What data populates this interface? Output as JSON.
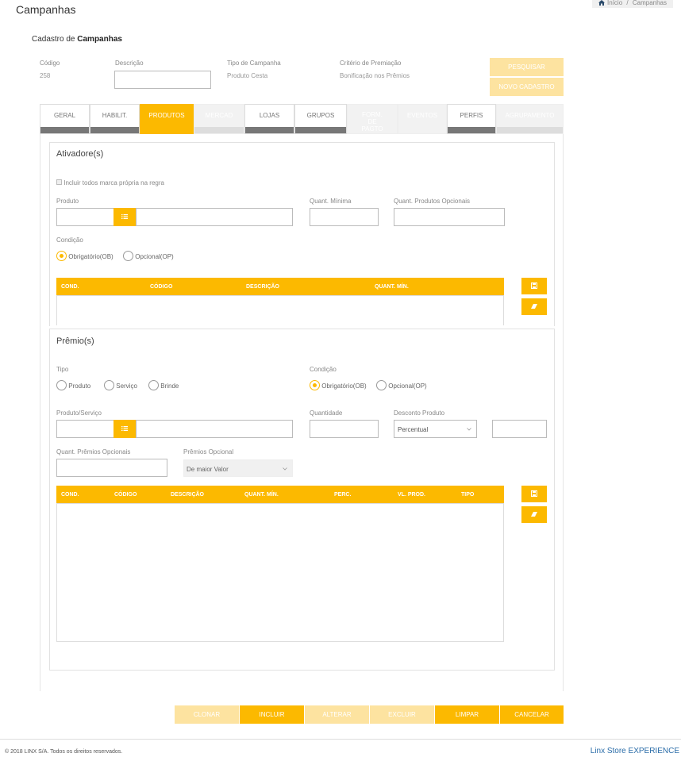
{
  "page": {
    "title": "Campanhas",
    "breadcrumb": {
      "home": "Início",
      "separator": "/",
      "current": "Campanhas"
    },
    "subtitle_prefix": "Cadastro de",
    "subtitle_bold": "Campanhas"
  },
  "header_fields": {
    "codigo_label": "Código",
    "codigo_value": "258",
    "descricao_label": "Descrição",
    "tipo_label": "Tipo de Campanha",
    "tipo_value": "Produto Cesta",
    "criterio_label": "Critério de Premiação",
    "criterio_value": "Bonificação nos Prêmios"
  },
  "actions": {
    "pesquisar": "PESQUISAR",
    "novo": "NOVO CADASTRO"
  },
  "tabs": [
    {
      "label": "GERAL",
      "state": "normal"
    },
    {
      "label": "HABILIT.",
      "state": "normal"
    },
    {
      "label": "PRODUTOS",
      "state": "active"
    },
    {
      "label": "MERCAD",
      "state": "disabled"
    },
    {
      "label": "LOJAS",
      "state": "normal"
    },
    {
      "label": "GRUPOS",
      "state": "normal"
    },
    {
      "label": "FORM. DE PAGTO",
      "state": "disabled"
    },
    {
      "label": "EVENTOS",
      "state": "disabled"
    },
    {
      "label": "PERFIS",
      "state": "normal"
    },
    {
      "label": "AGRUPAMENTO",
      "state": "disabled"
    }
  ],
  "ativadores": {
    "title": "Ativadore(s)",
    "checkbox_label": "Incluir todos marca própria na regra",
    "produto_label": "Produto",
    "quant_min_label": "Quant. Mínima",
    "quant_opc_label": "Quant. Produtos Opcionais",
    "condicao_label": "Condição",
    "radio_ob": "Obrigatório(OB)",
    "radio_op": "Opcional(OP)",
    "columns": [
      "COND.",
      "CÓDIGO",
      "DESCRIÇÃO",
      "QUANT. MÍN."
    ]
  },
  "premios": {
    "title": "Prêmio(s)",
    "tipo_label": "Tipo",
    "tipo_options": [
      "Produto",
      "Serviço",
      "Brinde"
    ],
    "condicao_label": "Condição",
    "radio_ob": "Obrigatório(OB)",
    "radio_op": "Opcional(OP)",
    "produto_servico_label": "Produto/Serviço",
    "quantidade_label": "Quantidade",
    "desconto_label": "Desconto Produto",
    "desconto_value": "Percentual",
    "quant_premios_label": "Quant. Prêmios Opcionais",
    "premios_opc_label": "Prêmios Opcional",
    "premios_opc_value": "De maior Valor",
    "columns": [
      "COND.",
      "CÓDIGO",
      "DESCRIÇÃO",
      "QUANT. MÍN.",
      "PERC.",
      "VL. PROD.",
      "TIPO"
    ]
  },
  "bottom_buttons": {
    "clonar": "CLONAR",
    "incluir": "INCLUIR",
    "alterar": "ALTERAR",
    "excluir": "EXCLUIR",
    "limpar": "LIMPAR",
    "cancelar": "CANCELAR"
  },
  "footer": {
    "copyright": "© 2018 LINX S/A. Todos os direitos reservados.",
    "brand": "Linx Store",
    "brand_suffix": "EXPERIENCE"
  },
  "colors": {
    "accent": "#fcb900",
    "accent_light": "#fde3a0",
    "brand_blue": "#2a6ca8"
  }
}
